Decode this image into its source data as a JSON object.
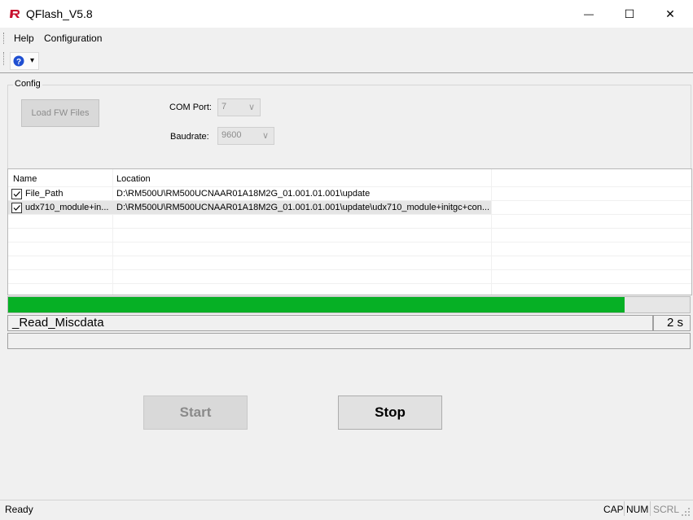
{
  "window": {
    "title": "QFlash_V5.8",
    "minimize_glyph": "—",
    "maximize_glyph": "☐",
    "close_glyph": "✕"
  },
  "menu": {
    "items": [
      {
        "label": "Help"
      },
      {
        "label": "Configuration"
      }
    ]
  },
  "toolbar": {
    "help_icon": "help-icon",
    "dropdown_glyph": "▾"
  },
  "config": {
    "legend": "Config",
    "load_fw_label": "Load FW Files",
    "com_port_label": "COM Port:",
    "com_port_value": "7",
    "baudrate_label": "Baudrate:",
    "baudrate_value": "9600",
    "dropdown_arrow": "∨"
  },
  "files": {
    "columns": [
      "Name",
      "Location"
    ],
    "rows": [
      {
        "checked": true,
        "name": "File_Path",
        "location": "D:\\RM500U\\RM500UCNAAR01A18M2G_01.001.01.001\\update"
      },
      {
        "checked": true,
        "name": "udx710_module+in...",
        "location": "D:\\RM500U\\RM500UCNAAR01A18M2G_01.001.01.001\\update\\udx710_module+initgc+con..."
      }
    ]
  },
  "progress": {
    "fraction": 0.904,
    "status_text": "_Read_Miscdata",
    "elapsed": "2 s",
    "color": "#06b025"
  },
  "actions": {
    "start_label": "Start",
    "stop_label": "Stop"
  },
  "statusbar": {
    "ready": "Ready",
    "cap": "CAP",
    "num": "NUM",
    "scrl": "SCRL"
  }
}
